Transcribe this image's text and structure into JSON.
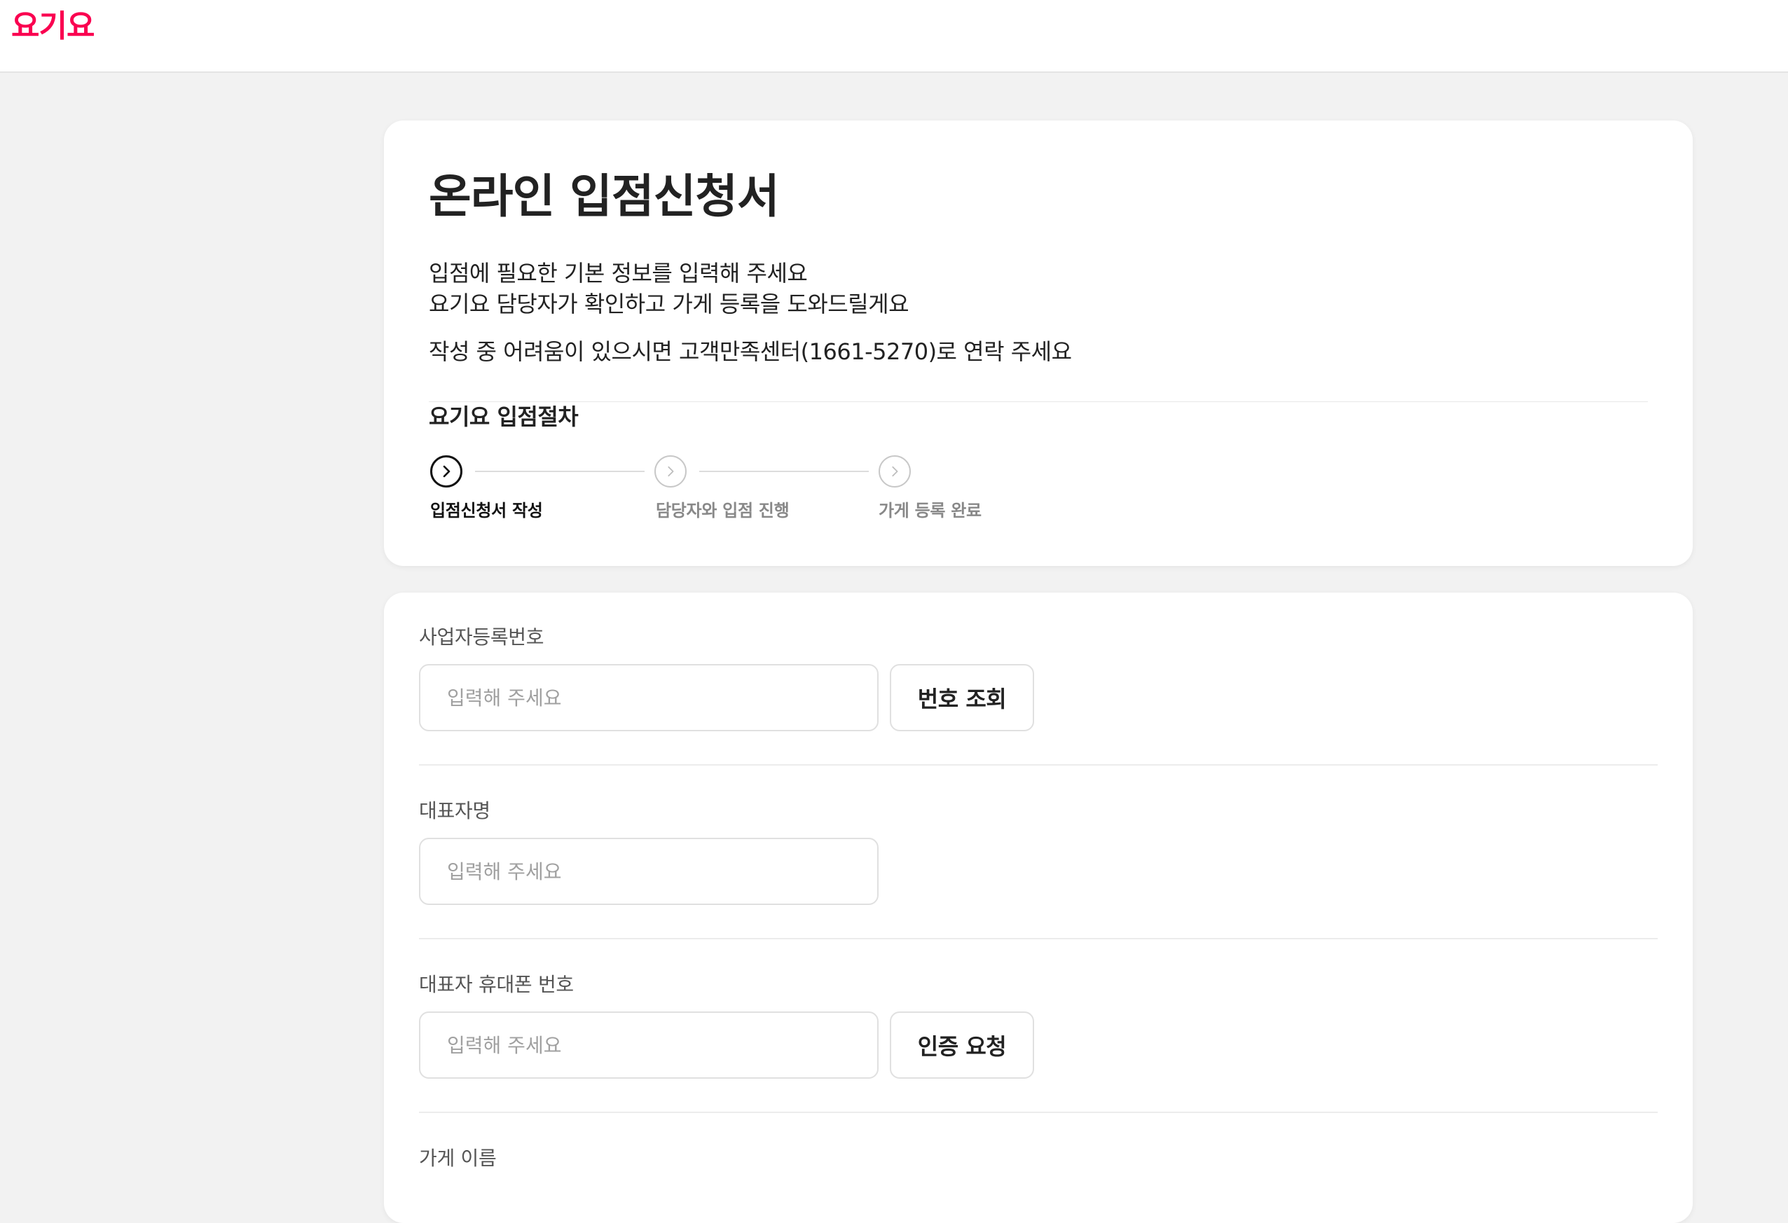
{
  "header": {
    "logo_text": "요기요",
    "brand_color": "#fa0050"
  },
  "intro": {
    "title": "온라인 입점신청서",
    "line1": "입점에 필요한 기본 정보를 입력해 주세요",
    "line2": "요기요 담당자가 확인하고 가게 등록을 도와드릴게요",
    "line3": "작성 중 어려움이 있으시면 고객만족센터(1661-5270)로 연락 주세요"
  },
  "steps": {
    "title": "요기요 입점절차",
    "items": [
      {
        "label": "입점신청서 작성",
        "icon": "chevron-right-icon",
        "active": true
      },
      {
        "label": "담당자와 입점 진행",
        "icon": "chevron-right-icon",
        "active": false
      },
      {
        "label": "가게 등록 완료",
        "icon": "chevron-right-icon",
        "active": false
      }
    ]
  },
  "form": {
    "business_number": {
      "label": "사업자등록번호",
      "placeholder": "입력해 주세요",
      "value": "",
      "button_label": "번호 조회"
    },
    "representative_name": {
      "label": "대표자명",
      "placeholder": "입력해 주세요",
      "value": ""
    },
    "representative_phone": {
      "label": "대표자 휴대폰 번호",
      "placeholder": "입력해 주세요",
      "value": "",
      "button_label": "인증 요청"
    },
    "store_name": {
      "label": "가게 이름"
    }
  }
}
